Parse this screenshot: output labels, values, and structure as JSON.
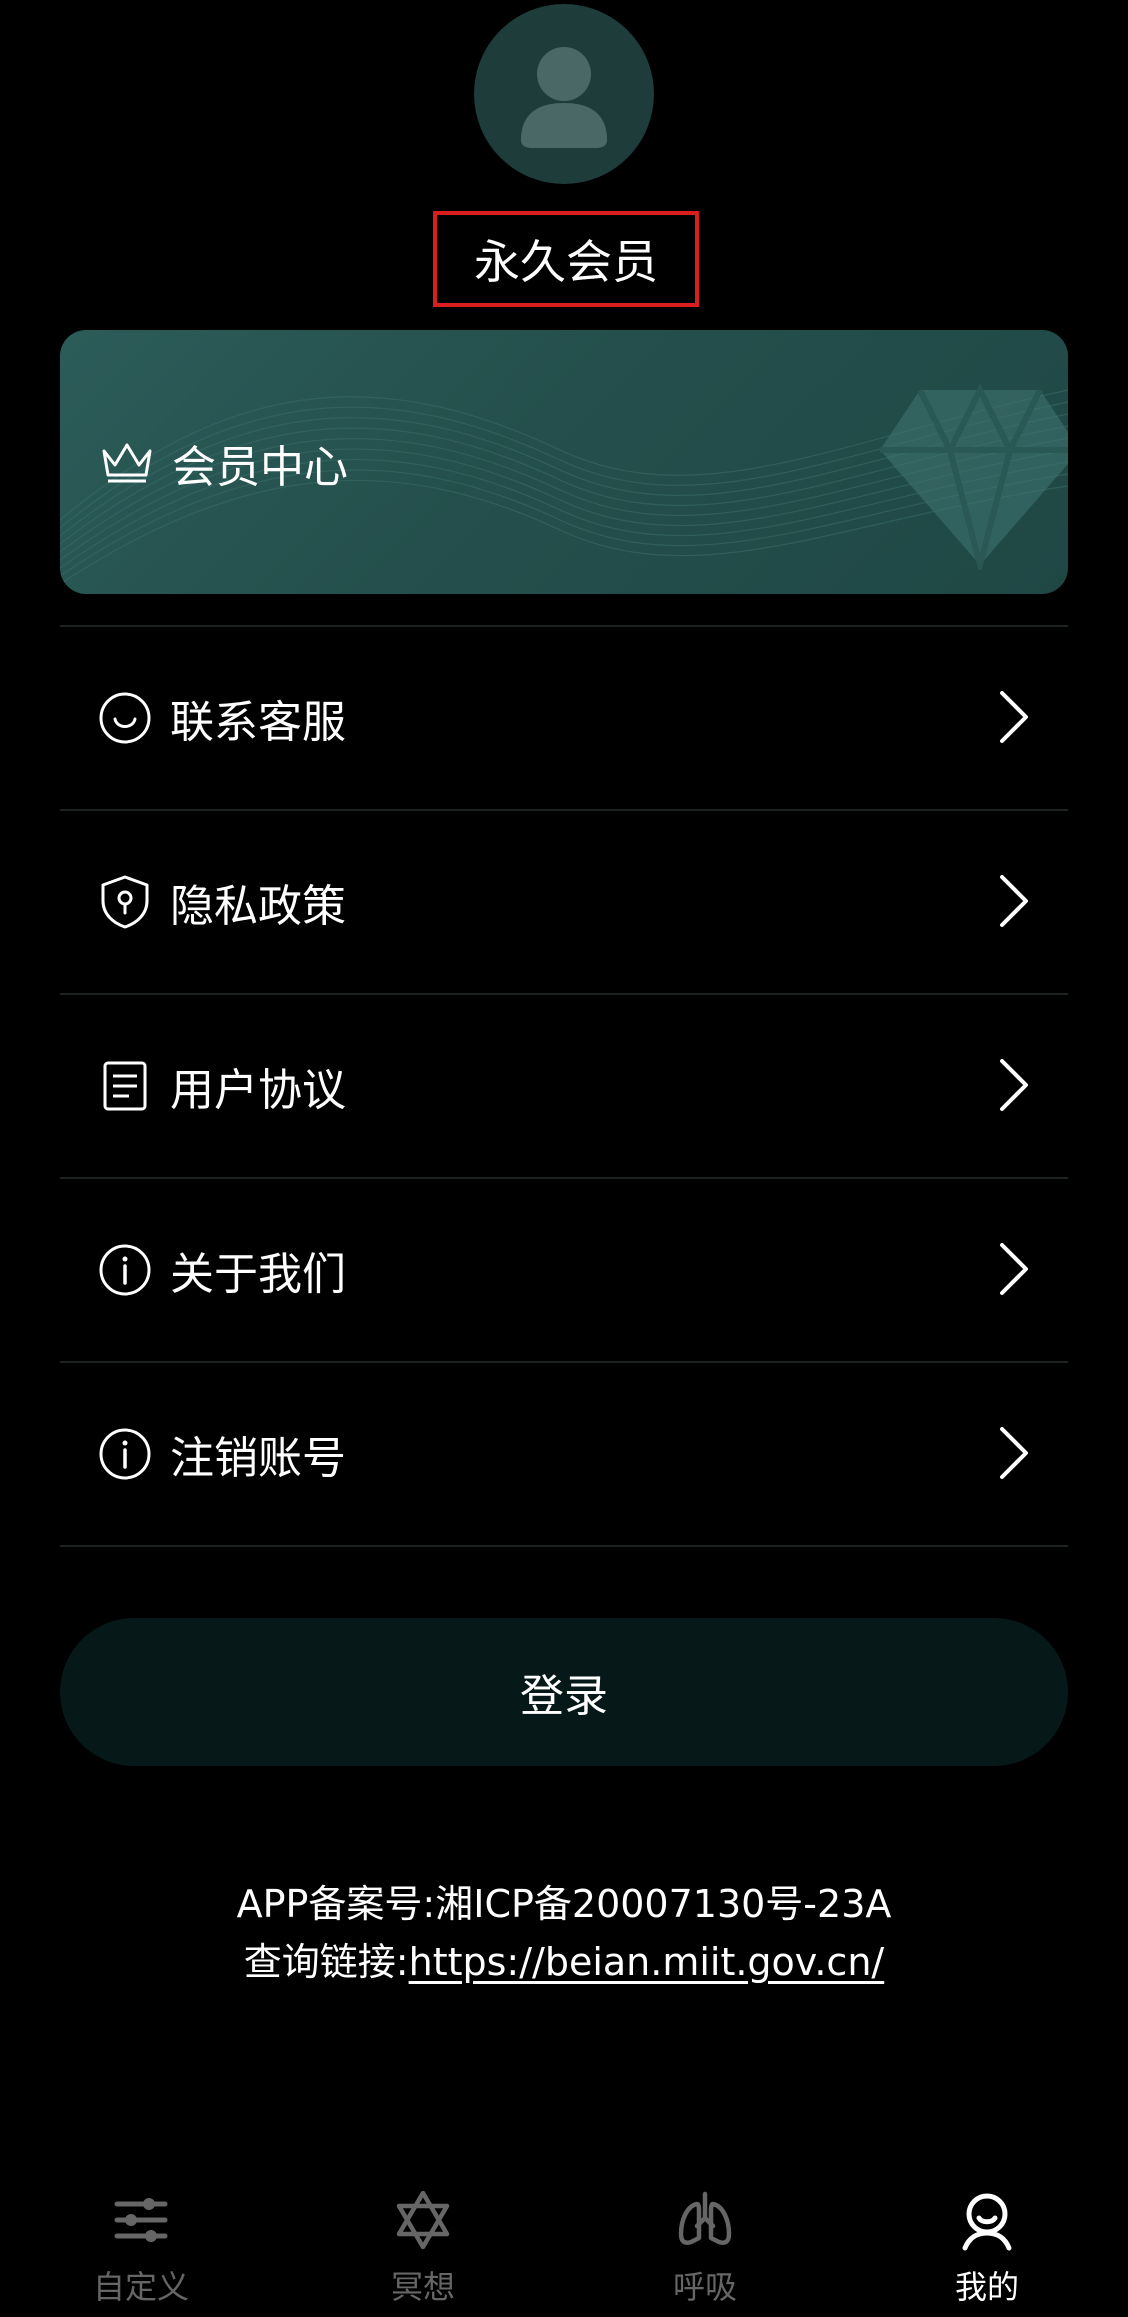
{
  "profile": {
    "avatar_icon": "user-avatar-icon",
    "status_label": "永久会员"
  },
  "vip_card": {
    "icon": "crown-icon",
    "label": "会员中心",
    "background_color": "#2c5c59"
  },
  "menu": [
    {
      "icon": "smiley-icon",
      "label": "联系客服"
    },
    {
      "icon": "shield-lock-icon",
      "label": "隐私政策"
    },
    {
      "icon": "document-icon",
      "label": "用户协议"
    },
    {
      "icon": "info-icon",
      "label": "关于我们"
    },
    {
      "icon": "info-icon",
      "label": "注销账号"
    }
  ],
  "login_button": {
    "label": "登录"
  },
  "icp": {
    "line1": "APP备案号:湘ICP备20007130号-23A",
    "query_prefix": "查询链接:",
    "query_link": "https://beian.miit.gov.cn/"
  },
  "tabbar": {
    "active": "我的",
    "tabs": [
      {
        "icon": "sliders-icon",
        "label": "自定义"
      },
      {
        "icon": "star-of-david-icon",
        "label": "冥想"
      },
      {
        "icon": "lungs-icon",
        "label": "呼吸"
      },
      {
        "icon": "profile-icon",
        "label": "我的"
      }
    ]
  },
  "colors": {
    "background": "#000000",
    "accent": "#2c5c59",
    "highlight_border": "#d81e1e",
    "inactive_tab": "#666666"
  }
}
